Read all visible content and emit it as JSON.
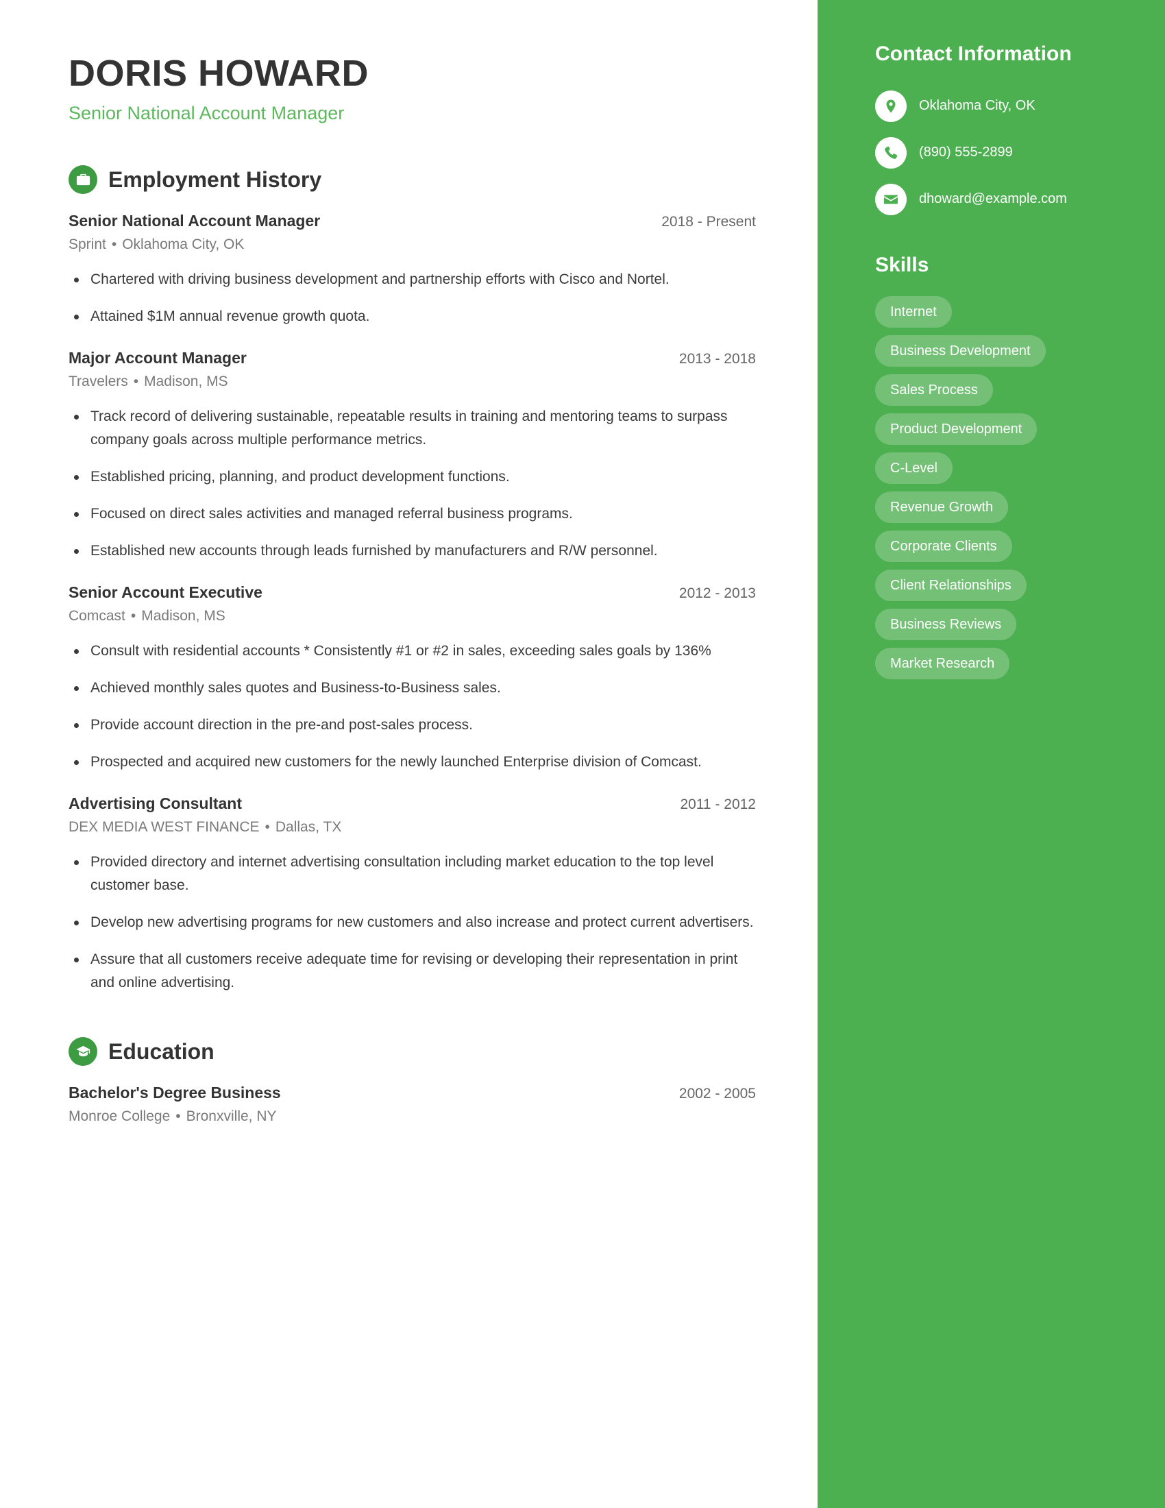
{
  "header": {
    "name": "DORIS HOWARD",
    "title": "Senior National Account Manager"
  },
  "sidebar": {
    "contact_heading": "Contact Information",
    "contact_items": [
      {
        "icon": "location-pin-icon",
        "value": "Oklahoma City, OK"
      },
      {
        "icon": "phone-icon",
        "value": "(890) 555-2899"
      },
      {
        "icon": "envelope-icon",
        "value": "dhoward@example.com"
      }
    ],
    "skills_heading": "Skills",
    "skills": [
      "Internet",
      "Business Development",
      "Sales Process",
      "Product Development",
      "C-Level",
      "Revenue Growth",
      "Corporate Clients",
      "Client Relationships",
      "Business Reviews",
      "Market Research"
    ]
  },
  "employment": {
    "section_title": "Employment History",
    "section_icon": "briefcase-icon",
    "entries": [
      {
        "role": "Senior National Account Manager",
        "dates": "2018 - Present",
        "company": "Sprint",
        "location": "Oklahoma City, OK",
        "bullets": [
          "Chartered with driving business development and partnership efforts with Cisco and Nortel.",
          "Attained $1M annual revenue growth quota."
        ]
      },
      {
        "role": "Major Account Manager",
        "dates": "2013 - 2018",
        "company": "Travelers",
        "location": "Madison, MS",
        "bullets": [
          "Track record of delivering sustainable, repeatable results in training and mentoring teams to surpass company goals across multiple performance metrics.",
          "Established pricing, planning, and product development functions.",
          "Focused on direct sales activities and managed referral business programs.",
          "Established new accounts through leads furnished by manufacturers and R/W personnel."
        ]
      },
      {
        "role": "Senior Account Executive",
        "dates": "2012 - 2013",
        "company": "Comcast",
        "location": "Madison, MS",
        "bullets": [
          "Consult with residential accounts * Consistently #1 or #2 in sales, exceeding sales goals by 136%",
          "Achieved monthly sales quotes and Business-to-Business sales.",
          "Provide account direction in the pre-and post-sales process.",
          "Prospected and acquired new customers for the newly launched Enterprise division of Comcast."
        ]
      },
      {
        "role": "Advertising Consultant",
        "dates": "2011 - 2012",
        "company": "DEX MEDIA WEST FINANCE",
        "location": "Dallas, TX",
        "bullets": [
          "Provided directory and internet advertising consultation including market education to the top level customer base.",
          "Develop new advertising programs for new customers and also increase and protect current advertisers.",
          "Assure that all customers receive adequate time for revising or developing their representation in print and online advertising."
        ]
      }
    ]
  },
  "education": {
    "section_title": "Education",
    "section_icon": "graduation-cap-icon",
    "entries": [
      {
        "degree": "Bachelor's Degree Business",
        "dates": "2002 - 2005",
        "school": "Monroe College",
        "location": "Bronxville, NY"
      }
    ]
  },
  "separator": "•",
  "colors": {
    "sidebar_green": "#4caf50",
    "accent_green": "#5cb85c",
    "icon_circle_green": "#3d9b41",
    "heading_dark": "#333333"
  }
}
